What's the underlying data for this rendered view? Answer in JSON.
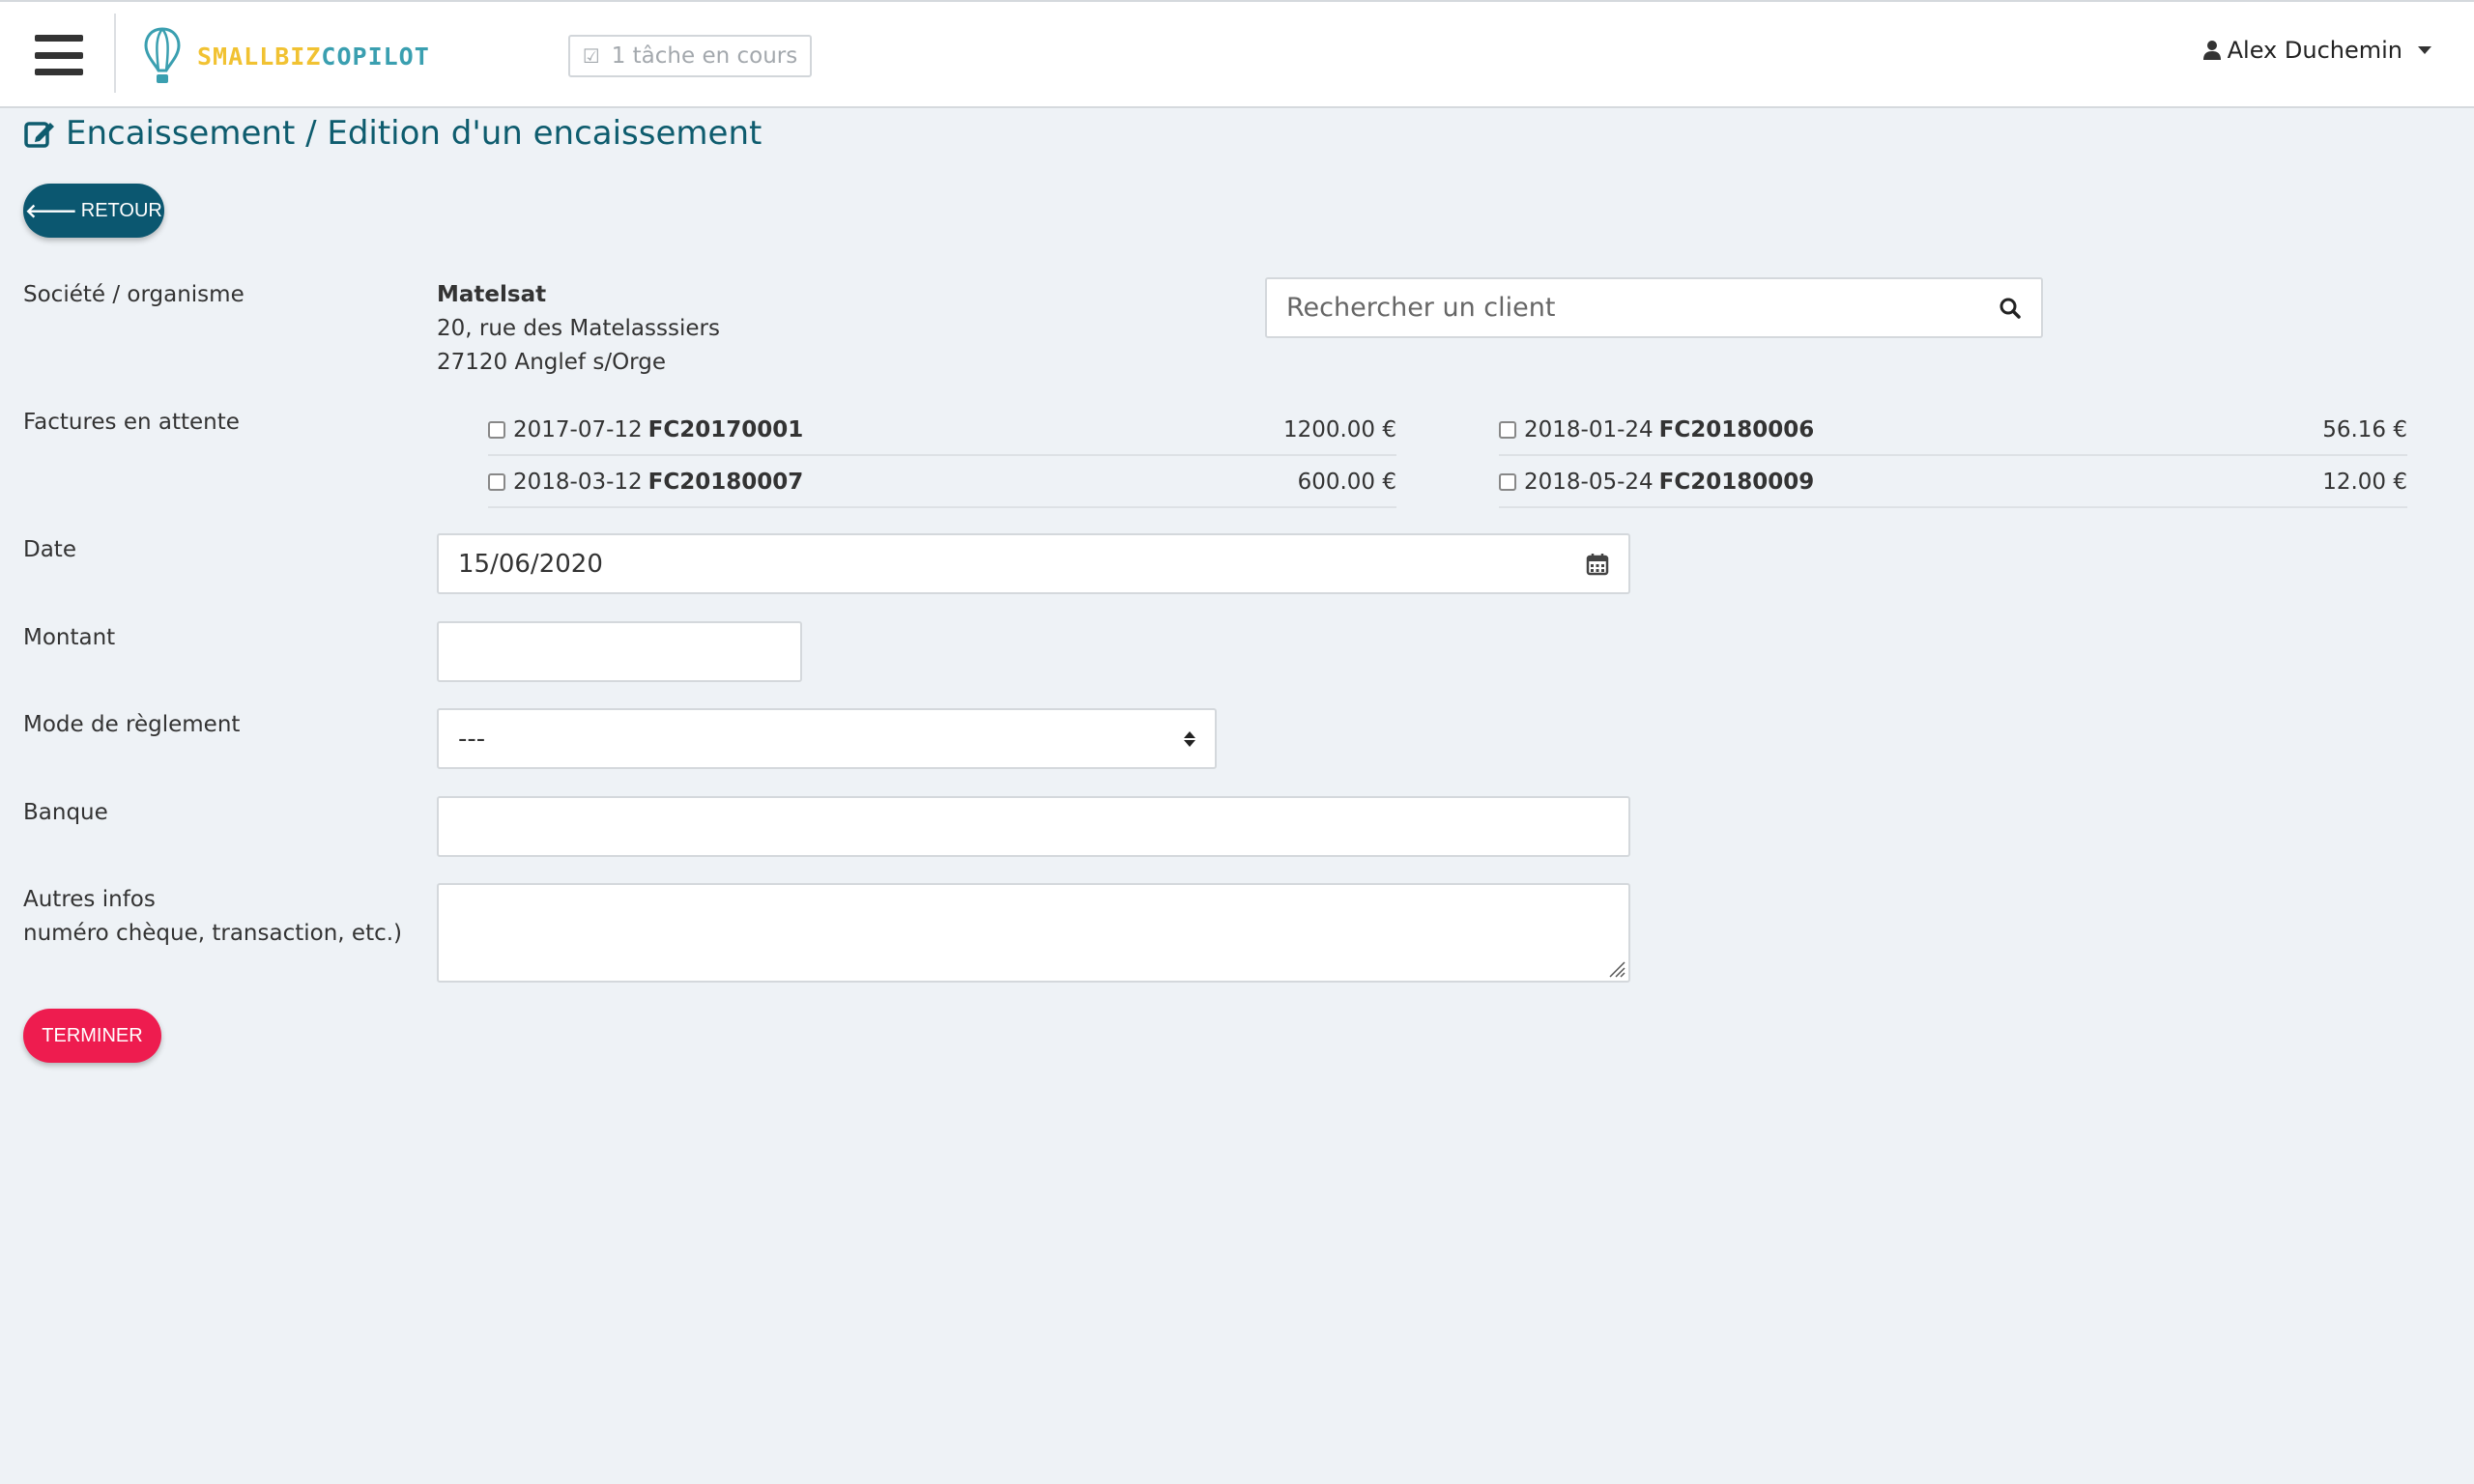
{
  "header": {
    "logo_part1": "SMALLBIZ",
    "logo_part2": "COPILOT",
    "task_status": "1 tâche en cours",
    "user_name": "Alex Duchemin"
  },
  "page": {
    "title": "Encaissement / Edition d'un encaissement",
    "back_label": "RETOUR",
    "finish_label": "TERMINER"
  },
  "form": {
    "company_label": "Société / organisme",
    "company": {
      "name": "Matelsat",
      "address1": "20, rue des Matelasssiers",
      "address2": "27120 Anglef s/Orge"
    },
    "search_placeholder": "Rechercher un client",
    "invoices_label": "Factures en attente",
    "invoices": [
      {
        "date": "2017-07-12",
        "number": "FC20170001",
        "amount": "1200.00 €",
        "checked": false
      },
      {
        "date": "2018-01-24",
        "number": "FC20180006",
        "amount": "56.16 €",
        "checked": false
      },
      {
        "date": "2018-03-12",
        "number": "FC20180007",
        "amount": "600.00 €",
        "checked": false
      },
      {
        "date": "2018-05-24",
        "number": "FC20180009",
        "amount": "12.00 €",
        "checked": false
      }
    ],
    "date_label": "Date",
    "date_value": "15/06/2020",
    "amount_label": "Montant",
    "amount_value": "",
    "payment_mode_label": "Mode de règlement",
    "payment_mode_value": "---",
    "bank_label": "Banque",
    "bank_value": "",
    "other_label_line1": "Autres infos",
    "other_label_line2": "numéro chèque, transaction, etc.)",
    "other_value": ""
  },
  "colors": {
    "primary": "#0b5770",
    "danger": "#ee1c4f",
    "title": "#0e5c6e",
    "logo_yellow": "#f1c232",
    "logo_teal": "#3a9fb0"
  }
}
